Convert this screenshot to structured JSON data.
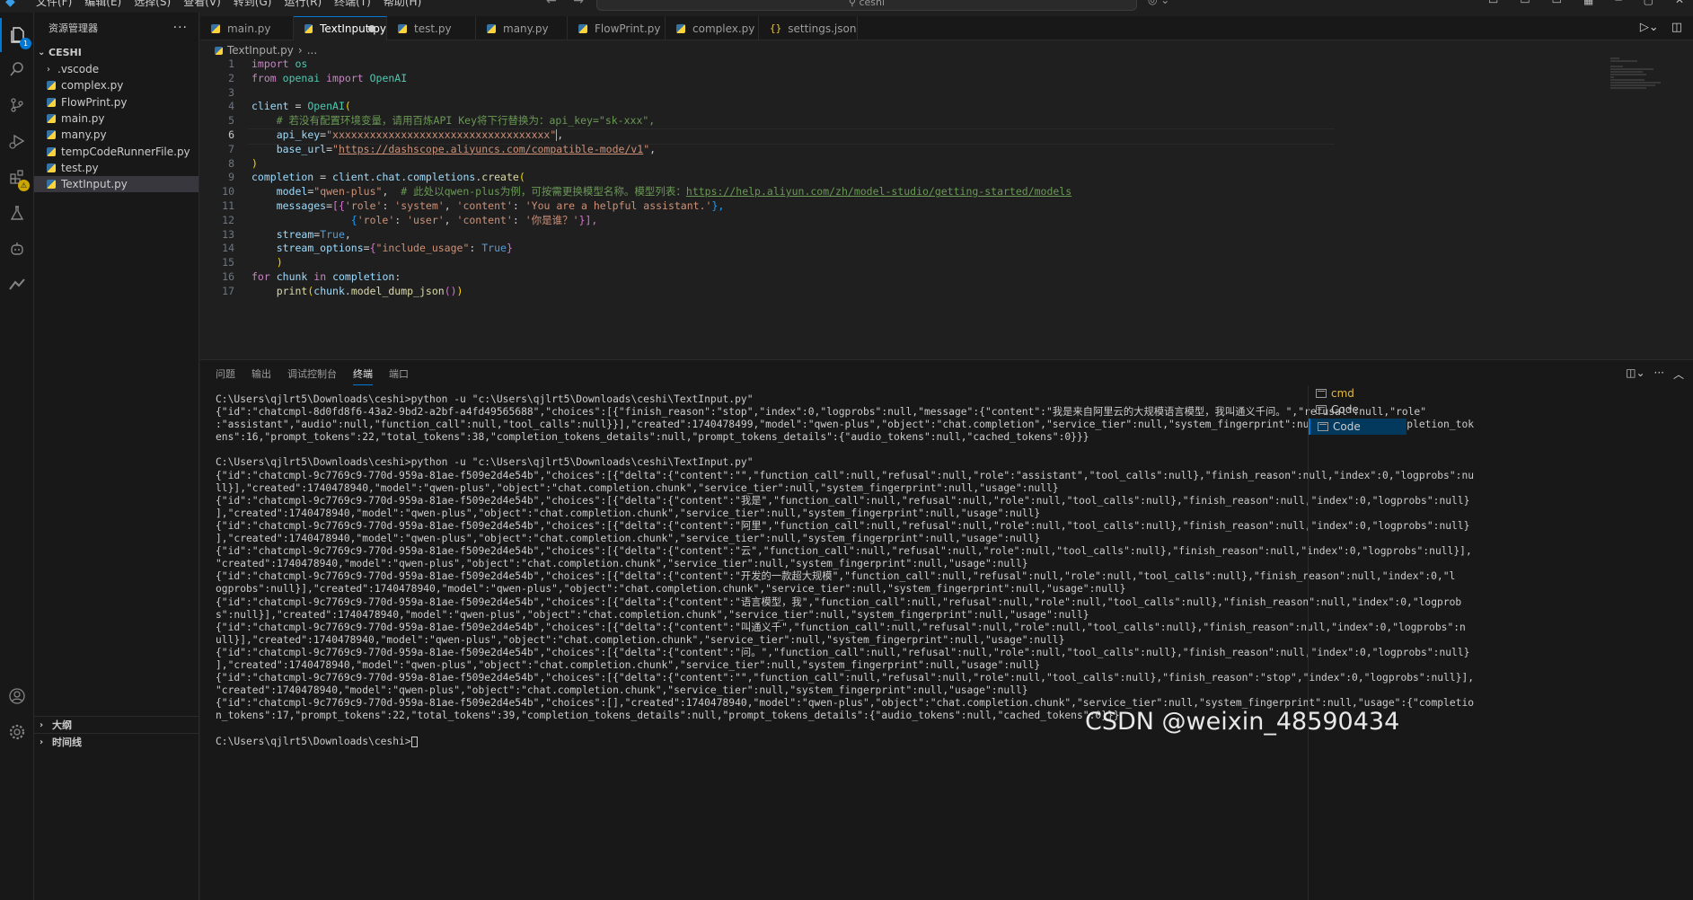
{
  "menu": {
    "items": [
      "文件(F)",
      "编辑(E)",
      "选择(S)",
      "查看(V)",
      "转到(G)",
      "运行(R)",
      "终端(T)",
      "帮助(H)"
    ],
    "search": "ceshi",
    "nav_back": "←",
    "nav_forward": "→"
  },
  "activity": {
    "explorer_badge": "1"
  },
  "sidebar": {
    "title": "资源管理器",
    "more": "···",
    "root": "CESHI",
    "items": [
      ".vscode",
      "complex.py",
      "FlowPrint.py",
      "main.py",
      "many.py",
      "tempCodeRunnerFile.py",
      "test.py",
      "TextInput.py"
    ],
    "outline": "大纲",
    "timeline": "时间线"
  },
  "tabs": [
    "main.py",
    "TextInput.py",
    "test.py",
    "many.py",
    "FlowPrint.py",
    "complex.py",
    "settings.json"
  ],
  "breadcrumb": {
    "file": "TextInput.py",
    "rest": "..."
  },
  "editor": {
    "line_numbers": [
      "1",
      "2",
      "3",
      "4",
      "5",
      "6",
      "7",
      "8",
      "9",
      "10",
      "11",
      "12",
      "13",
      "14",
      "15",
      "16",
      "17"
    ],
    "current_line": 6,
    "code": {
      "l1_kw": "import",
      "l1_mod": "os",
      "l2_from": "from",
      "l2_mod": "openai",
      "l2_import": "import",
      "l2_cls": "OpenAI",
      "l4_var": "client",
      "l4_eq": " = ",
      "l4_cls": "OpenAI",
      "l4_paren": "(",
      "l5_comment": "# 若没有配置环境变量，请用百炼API Key将下行替换为：api_key=\"sk-xxx\",",
      "l6_param": "api_key",
      "l6_eq": "=",
      "l6_str": "\"xxxxxxxxxxxxxxxxxxxxxxxxxxxxxxxxxxx\"",
      "l6_comma": ",",
      "l7_param": "base_url",
      "l7_eq": "=",
      "l7_q1": "\"",
      "l7_url": "https://dashscope.aliyuncs.com/compatible-mode/v1",
      "l7_q2": "\"",
      "l7_comma": ",",
      "l8_paren": ")",
      "l9_var": "completion",
      "l9_eq": " = ",
      "l9_obj": "client",
      "l9_d1": ".",
      "l9_chat": "chat",
      "l9_d2": ".",
      "l9_comp": "completions",
      "l9_d3": ".",
      "l9_fn": "create",
      "l9_paren": "(",
      "l10_param": "model",
      "l10_eq": "=",
      "l10_str": "\"qwen-plus\"",
      "l10_comma": ",  ",
      "l10_comment": "# 此处以qwen-plus为例，可按需更换模型名称。模型列表：",
      "l10_link": "https://help.aliyun.com/zh/model-studio/getting-started/models",
      "l11_param": "messages",
      "l11_eq": "=",
      "l11_open": "[{",
      "l11_k1": "'role'",
      "l11_c1": ": ",
      "l11_v1": "'system'",
      "l11_s1": ", ",
      "l11_k2": "'content'",
      "l11_c2": ": ",
      "l11_v2": "'You are a helpful assistant.'",
      "l11_close": "},",
      "l12_open": "{",
      "l12_k1": "'role'",
      "l12_c1": ": ",
      "l12_v1": "'user'",
      "l12_s1": ", ",
      "l12_k2": "'content'",
      "l12_c2": ": ",
      "l12_v2": "'你是谁？'",
      "l12_close": "}],",
      "l13_param": "stream",
      "l13_eq": "=",
      "l13_val": "True",
      "l13_comma": ",",
      "l14_param": "stream_options",
      "l14_eq": "=",
      "l14_open": "{",
      "l14_key": "\"include_usage\"",
      "l14_colon": ": ",
      "l14_val": "True",
      "l14_close": "}",
      "l15_paren": ")",
      "l16_for": "for",
      "l16_var": "chunk",
      "l16_in": "in",
      "l16_iter": "completion",
      "l16_colon": ":",
      "l17_fn": "print",
      "l17_open": "(",
      "l17_obj": "chunk",
      "l17_dot": ".",
      "l17_method": "model_dump_json",
      "l17_inner": "()",
      "l17_close": ")"
    }
  },
  "panel": {
    "tabs": [
      "问题",
      "输出",
      "调试控制台",
      "终端",
      "端口"
    ],
    "active_tab": "终端",
    "terminal_lines": [
      "C:\\Users\\qjlrt5\\Downloads\\ceshi>python -u \"c:\\Users\\qjlrt5\\Downloads\\ceshi\\TextInput.py\"",
      "{\"id\":\"chatcmpl-8d0fd8f6-43a2-9bd2-a2bf-a4fd49565688\",\"choices\":[{\"finish_reason\":\"stop\",\"index\":0,\"logprobs\":null,\"message\":{\"content\":\"我是来自阿里云的大规模语言模型，我叫通义千问。\",\"refusal\":null,\"role\"",
      ":\"assistant\",\"audio\":null,\"function_call\":null,\"tool_calls\":null}}],\"created\":1740478499,\"model\":\"qwen-plus\",\"object\":\"chat.completion\",\"service_tier\":null,\"system_fingerprint\":null,\"usage\":{\"completion_tok",
      "ens\":16,\"prompt_tokens\":22,\"total_tokens\":38,\"completion_tokens_details\":null,\"prompt_tokens_details\":{\"audio_tokens\":null,\"cached_tokens\":0}}}",
      "",
      "C:\\Users\\qjlrt5\\Downloads\\ceshi>python -u \"c:\\Users\\qjlrt5\\Downloads\\ceshi\\TextInput.py\"",
      "{\"id\":\"chatcmpl-9c7769c9-770d-959a-81ae-f509e2d4e54b\",\"choices\":[{\"delta\":{\"content\":\"\",\"function_call\":null,\"refusal\":null,\"role\":\"assistant\",\"tool_calls\":null},\"finish_reason\":null,\"index\":0,\"logprobs\":nu",
      "ll}],\"created\":1740478940,\"model\":\"qwen-plus\",\"object\":\"chat.completion.chunk\",\"service_tier\":null,\"system_fingerprint\":null,\"usage\":null}",
      "{\"id\":\"chatcmpl-9c7769c9-770d-959a-81ae-f509e2d4e54b\",\"choices\":[{\"delta\":{\"content\":\"我是\",\"function_call\":null,\"refusal\":null,\"role\":null,\"tool_calls\":null},\"finish_reason\":null,\"index\":0,\"logprobs\":null}",
      "],\"created\":1740478940,\"model\":\"qwen-plus\",\"object\":\"chat.completion.chunk\",\"service_tier\":null,\"system_fingerprint\":null,\"usage\":null}",
      "{\"id\":\"chatcmpl-9c7769c9-770d-959a-81ae-f509e2d4e54b\",\"choices\":[{\"delta\":{\"content\":\"阿里\",\"function_call\":null,\"refusal\":null,\"role\":null,\"tool_calls\":null},\"finish_reason\":null,\"index\":0,\"logprobs\":null}",
      "],\"created\":1740478940,\"model\":\"qwen-plus\",\"object\":\"chat.completion.chunk\",\"service_tier\":null,\"system_fingerprint\":null,\"usage\":null}",
      "{\"id\":\"chatcmpl-9c7769c9-770d-959a-81ae-f509e2d4e54b\",\"choices\":[{\"delta\":{\"content\":\"云\",\"function_call\":null,\"refusal\":null,\"role\":null,\"tool_calls\":null},\"finish_reason\":null,\"index\":0,\"logprobs\":null}],",
      "\"created\":1740478940,\"model\":\"qwen-plus\",\"object\":\"chat.completion.chunk\",\"service_tier\":null,\"system_fingerprint\":null,\"usage\":null}",
      "{\"id\":\"chatcmpl-9c7769c9-770d-959a-81ae-f509e2d4e54b\",\"choices\":[{\"delta\":{\"content\":\"开发的一款超大规模\",\"function_call\":null,\"refusal\":null,\"role\":null,\"tool_calls\":null},\"finish_reason\":null,\"index\":0,\"l",
      "ogprobs\":null}],\"created\":1740478940,\"model\":\"qwen-plus\",\"object\":\"chat.completion.chunk\",\"service_tier\":null,\"system_fingerprint\":null,\"usage\":null}",
      "{\"id\":\"chatcmpl-9c7769c9-770d-959a-81ae-f509e2d4e54b\",\"choices\":[{\"delta\":{\"content\":\"语言模型，我\",\"function_call\":null,\"refusal\":null,\"role\":null,\"tool_calls\":null},\"finish_reason\":null,\"index\":0,\"logprob",
      "s\":null}],\"created\":1740478940,\"model\":\"qwen-plus\",\"object\":\"chat.completion.chunk\",\"service_tier\":null,\"system_fingerprint\":null,\"usage\":null}",
      "{\"id\":\"chatcmpl-9c7769c9-770d-959a-81ae-f509e2d4e54b\",\"choices\":[{\"delta\":{\"content\":\"叫通义千\",\"function_call\":null,\"refusal\":null,\"role\":null,\"tool_calls\":null},\"finish_reason\":null,\"index\":0,\"logprobs\":n",
      "ull}],\"created\":1740478940,\"model\":\"qwen-plus\",\"object\":\"chat.completion.chunk\",\"service_tier\":null,\"system_fingerprint\":null,\"usage\":null}",
      "{\"id\":\"chatcmpl-9c7769c9-770d-959a-81ae-f509e2d4e54b\",\"choices\":[{\"delta\":{\"content\":\"问。\",\"function_call\":null,\"refusal\":null,\"role\":null,\"tool_calls\":null},\"finish_reason\":null,\"index\":0,\"logprobs\":null}",
      "],\"created\":1740478940,\"model\":\"qwen-plus\",\"object\":\"chat.completion.chunk\",\"service_tier\":null,\"system_fingerprint\":null,\"usage\":null}",
      "{\"id\":\"chatcmpl-9c7769c9-770d-959a-81ae-f509e2d4e54b\",\"choices\":[{\"delta\":{\"content\":\"\",\"function_call\":null,\"refusal\":null,\"role\":null,\"tool_calls\":null},\"finish_reason\":\"stop\",\"index\":0,\"logprobs\":null}],",
      "\"created\":1740478940,\"model\":\"qwen-plus\",\"object\":\"chat.completion.chunk\",\"service_tier\":null,\"system_fingerprint\":null,\"usage\":null}",
      "{\"id\":\"chatcmpl-9c7769c9-770d-959a-81ae-f509e2d4e54b\",\"choices\":[],\"created\":1740478940,\"model\":\"qwen-plus\",\"object\":\"chat.completion.chunk\",\"service_tier\":null,\"system_fingerprint\":null,\"usage\":{\"completio",
      "n_tokens\":17,\"prompt_tokens\":22,\"total_tokens\":39,\"completion_tokens_details\":null,\"prompt_tokens_details\":{\"audio_tokens\":null,\"cached_tokens\":0}}}",
      ""
    ],
    "prompt": "C:\\Users\\qjlrt5\\Downloads\\ceshi>",
    "terminal_list": [
      "cmd",
      "Code",
      "Code"
    ]
  },
  "watermark": "CSDN @weixin_48590434",
  "colors": {
    "accent": "#0078d4",
    "editor_bg": "#1f1f1f",
    "sidebar_bg": "#181818",
    "keyword": "#c586c0",
    "string": "#ce9178",
    "comment": "#6a9955"
  }
}
